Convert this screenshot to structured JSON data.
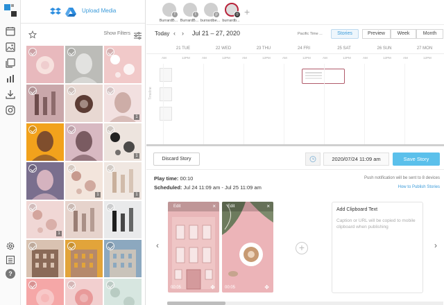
{
  "media": {
    "upload_label": "Upload Media",
    "show_filters_label": "Show Filters",
    "tiles": [
      {
        "bg": "#e8b9bd",
        "fg": "#f7e1de",
        "count": ""
      },
      {
        "bg": "#bcbcb8",
        "fg": "#e9e9e6",
        "count": ""
      },
      {
        "bg": "#f1c9c9",
        "fg": "#ffffff",
        "count": ""
      },
      {
        "bg": "#c9a7aa",
        "fg": "#6d4c4c",
        "count": ""
      },
      {
        "bg": "#e8d8d2",
        "fg": "#5c3c34",
        "count": ""
      },
      {
        "bg": "#f2e0e0",
        "fg": "#c7a39c",
        "count": "1"
      },
      {
        "bg": "#f2a21c",
        "fg": "#6b4030",
        "count": ""
      },
      {
        "bg": "#d8b9c2",
        "fg": "#6a4a50",
        "count": ""
      },
      {
        "bg": "#ede4de",
        "fg": "#222222",
        "count": "1"
      },
      {
        "bg": "#7a6f8e",
        "fg": "#e5c0c8",
        "count": ""
      },
      {
        "bg": "#f3e5dc",
        "fg": "#c79a8e",
        "count": "1"
      },
      {
        "bg": "#f0e7e1",
        "fg": "#c9b09c",
        "count": "1"
      },
      {
        "bg": "#f0d7d5",
        "fg": "#d3a59d",
        "count": "1"
      },
      {
        "bg": "#e6d3cc",
        "fg": "#9a7e74",
        "count": ""
      },
      {
        "bg": "#e9eaeb",
        "fg": "#1e1e1e",
        "count": ""
      },
      {
        "bg": "#d9c2b1",
        "fg": "#8a6a58",
        "count": ""
      },
      {
        "bg": "#e2a43a",
        "fg": "#b5896b",
        "count": ""
      },
      {
        "bg": "#8ca8bf",
        "fg": "#c9c3ba",
        "count": ""
      },
      {
        "bg": "#f5a7a7",
        "fg": "#f7c8c8",
        "count": ""
      },
      {
        "bg": "#f2cfcf",
        "fg": "#e89a9a",
        "count": ""
      },
      {
        "bg": "#d7e6e0",
        "fg": "#b8cbc2",
        "count": ""
      }
    ]
  },
  "profiles": [
    {
      "name": "BurrardB...",
      "network": "f"
    },
    {
      "name": "BurrardB...",
      "network": "t"
    },
    {
      "name": "burrardbe...",
      "network": "p"
    },
    {
      "name": "burrardb...",
      "network": "ig",
      "selected": true
    }
  ],
  "calendar": {
    "today_label": "Today",
    "range_label": "Jul 21 – 27, 2020",
    "timezone_label": "Pacific Time ...",
    "stories_label": "Stories",
    "view_buttons": [
      "Preview",
      "Week",
      "Month"
    ],
    "days": [
      "21 TUE",
      "22 WED",
      "23 THU",
      "24 FRI",
      "25 SAT",
      "26 SUN",
      "27 MON"
    ],
    "hour_labels": [
      "AM",
      "12PM",
      "AM",
      "12PM",
      "AM",
      "12PM",
      "AM",
      "12PM",
      "AM",
      "12PM",
      "AM",
      "12PM",
      "AM",
      "12PM"
    ],
    "timeline_label": "Timeline"
  },
  "editor": {
    "discard_label": "Discard Story",
    "date_value": "2020/07/24 11:09 am",
    "save_label": "Save Story",
    "play_time_label": "Play time:",
    "play_time_value": "00:10",
    "scheduled_label": "Scheduled:",
    "scheduled_value": "Jul 24 11:09 am - Jul 25 11:09 am",
    "push_note": "Push notification will be sent to 8 devices",
    "how_to_label": "How to Publish Stories",
    "frames": [
      {
        "edit_label": "Edit",
        "duration": "00:05",
        "bg": "#e9b7b9"
      },
      {
        "edit_label": "Edit",
        "duration": "00:05",
        "bg": "#ecb4b8"
      }
    ],
    "clipboard": {
      "title": "Add Clipboard Text",
      "placeholder": "Caption or URL will be copied to mobile clipboard when publishing"
    }
  },
  "colors": {
    "accent": "#5bc0eb",
    "link": "#3a9ad9",
    "selected_ring": "#b8233a"
  }
}
